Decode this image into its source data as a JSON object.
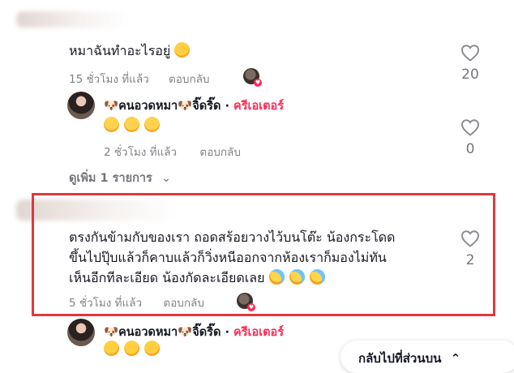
{
  "comments": [
    {
      "text": "หมาฉันทำอะไรอยู่",
      "time": "15 ชั่วโมง ที่แล้ว",
      "reply_label": "ตอบกลับ",
      "likes": "20",
      "replies": [
        {
          "author": "คนอวดหมา",
          "author_suffix": "จิ๊ดริ๊ด",
          "badge": "ครีเอเตอร์",
          "time": "2 ชั่วโมง ที่แล้ว",
          "reply_label": "ตอบกลับ",
          "likes": "0"
        }
      ],
      "more_replies": "ดูเพิ่ม 1 รายการ"
    },
    {
      "text_lines": [
        "ตรงกันข้ามกับของเรา ถอดสร้อยวางไว้บนโต๊ะ น้องกระโดด",
        "ขึ้นไปปุ๊บแล้วก็คาบแล้วก็วิ่งหนีออกจากห้องเราก็มองไม่ทัน",
        "เห็นอีกทีละเอียด น้องกัดละเอียดเลย"
      ],
      "time": "5 ชั่วโมง ที่แล้ว",
      "reply_label": "ตอบกลับ",
      "likes": "2",
      "replies": [
        {
          "author": "คนอวดหมา",
          "author_suffix": "จิ๊ดริ๊ด",
          "badge": "ครีเอเตอร์"
        }
      ]
    }
  ],
  "back_to_top": "กลับไปที่ส่วนบน",
  "colors": {
    "accent": "#fe2c55",
    "highlight": "#e0383e",
    "muted": "#8a8b91"
  }
}
